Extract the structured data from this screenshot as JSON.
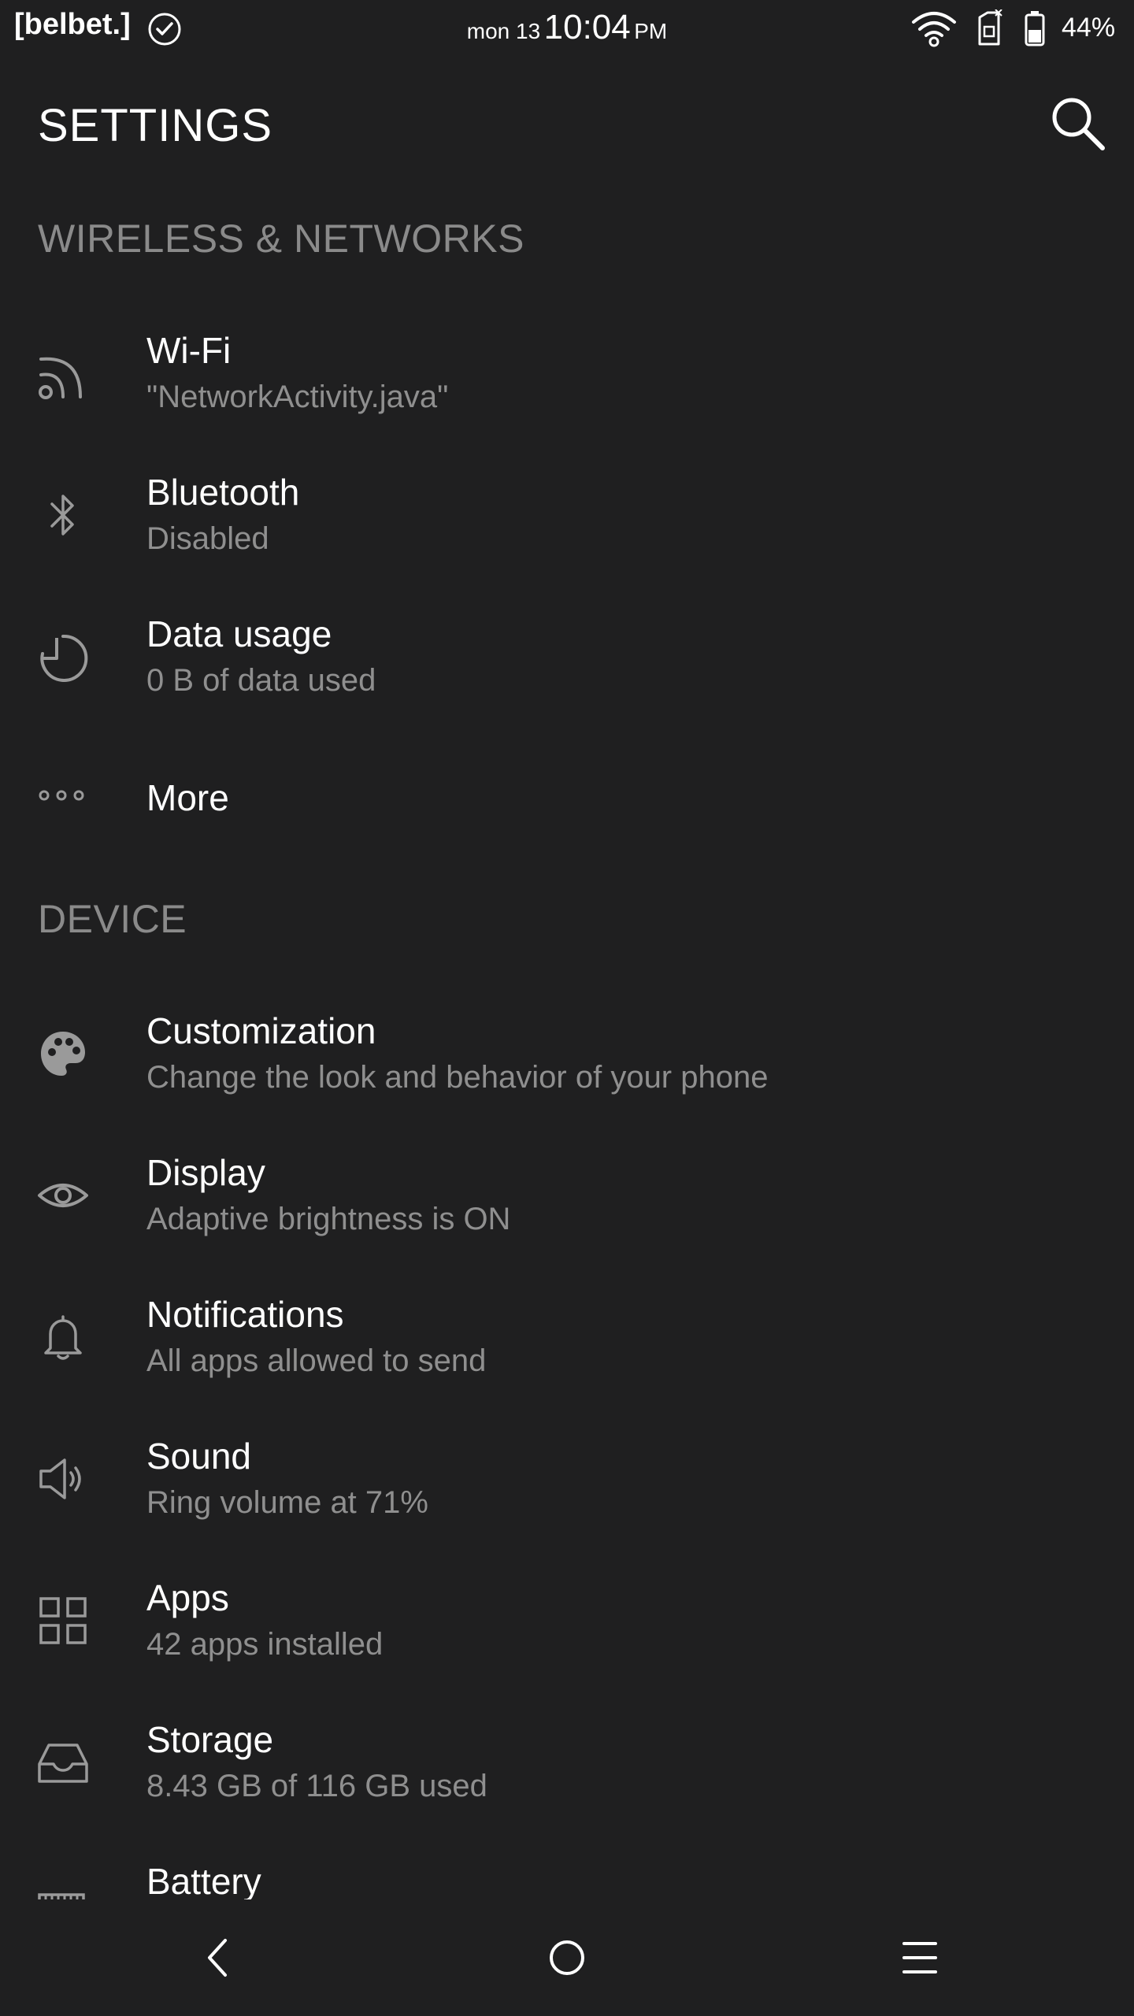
{
  "status_bar": {
    "carrier": "[belbet.]",
    "day": "mon 13",
    "time": "10:04",
    "ampm": "PM",
    "battery": "44%"
  },
  "app_bar": {
    "title": "SETTINGS"
  },
  "sections": {
    "wireless": {
      "header": "WIRELESS & NETWORKS",
      "items": [
        {
          "label": "Wi-Fi",
          "sub": "\"NetworkActivity.java\"",
          "icon": "wifi-icon"
        },
        {
          "label": "Bluetooth",
          "sub": "Disabled",
          "icon": "bluetooth-icon"
        },
        {
          "label": "Data usage",
          "sub": "0 B of data used",
          "icon": "data-usage-icon"
        },
        {
          "label": "More",
          "icon": "more-icon"
        }
      ]
    },
    "device": {
      "header": "DEVICE",
      "items": [
        {
          "label": "Customization",
          "sub": "Change the look and behavior of your phone",
          "icon": "palette-icon"
        },
        {
          "label": "Display",
          "sub": "Adaptive brightness is ON",
          "icon": "eye-icon"
        },
        {
          "label": "Notifications",
          "sub": "All apps allowed to send",
          "icon": "bell-icon"
        },
        {
          "label": "Sound",
          "sub": "Ring volume at 71%",
          "icon": "speaker-icon"
        },
        {
          "label": "Apps",
          "sub": "42 apps installed",
          "icon": "grid-icon"
        },
        {
          "label": "Storage",
          "sub": "8.43 GB of 116 GB used",
          "icon": "inbox-icon"
        },
        {
          "label": "Battery",
          "icon": "battery-icon"
        }
      ]
    }
  },
  "colors": {
    "background": "#1f1f20",
    "primary_text": "#ffffff",
    "secondary_text": "#8f8f8f",
    "header_text": "#8a8a8a",
    "icon": "#9a9a9a"
  }
}
